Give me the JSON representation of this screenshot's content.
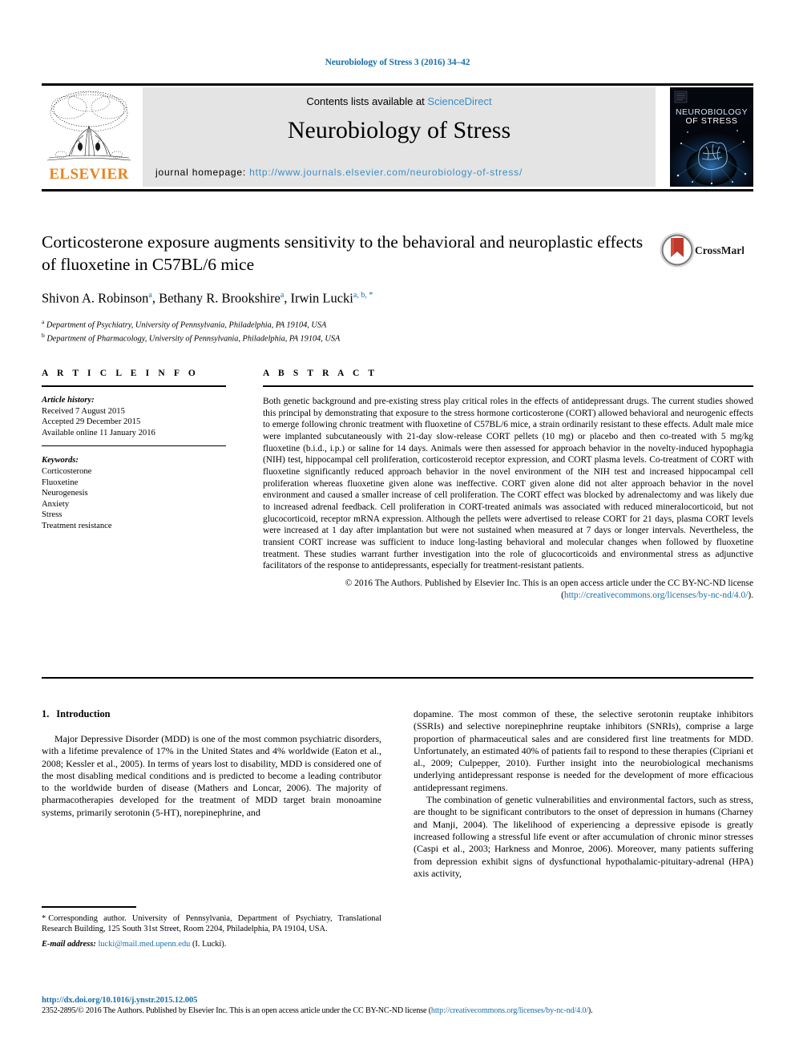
{
  "running_head": "Neurobiology of Stress 3 (2016) 34–42",
  "masthead": {
    "publisher_logo_name": "ELSEVIER",
    "contents_prefix": "Contents lists available at",
    "contents_link": "ScienceDirect",
    "journal_title": "Neurobiology of Stress",
    "homepage_label": "journal homepage:",
    "homepage_url": "http://www.journals.elsevier.com/neurobiology-of-stress/",
    "cover_line1": "NEUROBIOLOGY",
    "cover_line2": "OF STRESS"
  },
  "title_block": {
    "title": "Corticosterone exposure augments sensitivity to the behavioral and neuroplastic effects of fluoxetine in C57BL/6 mice",
    "authors": [
      {
        "name": "Shivon A. Robinson",
        "marks": "a"
      },
      {
        "name": "Bethany R. Brookshire",
        "marks": "a"
      },
      {
        "name": "Irwin Lucki",
        "marks": "a, b, *"
      }
    ],
    "affiliations": [
      {
        "mark": "a",
        "text": "Department of Psychiatry, University of Pennsylvania, Philadelphia, PA 19104, USA"
      },
      {
        "mark": "b",
        "text": "Department of Pharmacology, University of Pennsylvania, Philadelphia, PA 19104, USA"
      }
    ],
    "crossmark_label": "CrossMark"
  },
  "article_info": {
    "heading": "A R T I C L E  I N F O",
    "history_label": "Article history:",
    "history": [
      "Received 7 August 2015",
      "Accepted 29 December 2015",
      "Available online 11 January 2016"
    ],
    "keywords_label": "Keywords:",
    "keywords": [
      "Corticosterone",
      "Fluoxetine",
      "Neurogenesis",
      "Anxiety",
      "Stress",
      "Treatment resistance"
    ]
  },
  "abstract": {
    "heading": "A B S T R A C T",
    "text": "Both genetic background and pre-existing stress play critical roles in the effects of antidepressant drugs. The current studies showed this principal by demonstrating that exposure to the stress hormone corticosterone (CORT) allowed behavioral and neurogenic effects to emerge following chronic treatment with fluoxetine of C57BL/6 mice, a strain ordinarily resistant to these effects. Adult male mice were implanted subcutaneously with 21-day slow-release CORT pellets (10 mg) or placebo and then co-treated with 5 mg/kg fluoxetine (b.i.d., i.p.) or saline for 14 days. Animals were then assessed for approach behavior in the novelty-induced hypophagia (NIH) test, hippocampal cell proliferation, corticosteroid receptor expression, and CORT plasma levels. Co-treatment of CORT with fluoxetine significantly reduced approach behavior in the novel environment of the NIH test and increased hippocampal cell proliferation whereas fluoxetine given alone was ineffective. CORT given alone did not alter approach behavior in the novel environment and caused a smaller increase of cell proliferation. The CORT effect was blocked by adrenalectomy and was likely due to increased adrenal feedback. Cell proliferation in CORT-treated animals was associated with reduced mineralocorticoid, but not glucocorticoid, receptor mRNA expression. Although the pellets were advertised to release CORT for 21 days, plasma CORT levels were increased at 1 day after implantation but were not sustained when measured at 7 days or longer intervals. Nevertheless, the transient CORT increase was sufficient to induce long-lasting behavioral and molecular changes when followed by fluoxetine treatment. These studies warrant further investigation into the role of glucocorticoids and environmental stress as adjunctive facilitators of the response to antidepressants, especially for treatment-resistant patients.",
    "copyright_text": "© 2016 The Authors. Published by Elsevier Inc. This is an open access article under the CC BY-NC-ND license (",
    "copyright_link": "http://creativecommons.org/licenses/by-nc-nd/4.0/",
    "copyright_tail": ")."
  },
  "body": {
    "section_number": "1.",
    "section_title": "Introduction",
    "left_paragraphs": [
      "Major Depressive Disorder (MDD) is one of the most common psychiatric disorders, with a lifetime prevalence of 17% in the United States and 4% worldwide (Eaton et al., 2008; Kessler et al., 2005). In terms of years lost to disability, MDD is considered one of the most disabling medical conditions and is predicted to become a leading contributor to the worldwide burden of disease (Mathers and Loncar, 2006). The majority of pharmacotherapies developed for the treatment of MDD target brain monoamine systems, primarily serotonin (5-HT), norepinephrine, and"
    ],
    "right_paragraphs": [
      "dopamine. The most common of these, the selective serotonin reuptake inhibitors (SSRIs) and selective norepinephrine reuptake inhibitors (SNRIs), comprise a large proportion of pharmaceutical sales and are considered first line treatments for MDD. Unfortunately, an estimated 40% of patients fail to respond to these therapies (Cipriani et al., 2009; Culpepper, 2010). Further insight into the neurobiological mechanisms underlying antidepressant response is needed for the development of more efficacious antidepressant regimens.",
      "The combination of genetic vulnerabilities and environmental factors, such as stress, are thought to be significant contributors to the onset of depression in humans (Charney and Manji, 2004). The likelihood of experiencing a depressive episode is greatly increased following a stressful life event or after accumulation of chronic minor stresses (Caspi et al., 2003; Harkness and Monroe, 2006). Moreover, many patients suffering from depression exhibit signs of dysfunctional hypothalamic-pituitary-adrenal (HPA) axis activity,"
    ]
  },
  "footnotes": {
    "corresponding": "Corresponding author. University of Pennsylvania, Department of Psychiatry, Translational Research Building, 125 South 31st Street, Room 2204, Philadelphia, PA 19104, USA.",
    "email_label": "E-mail address:",
    "email": "lucki@mail.med.upenn.edu",
    "email_owner": "(I. Lucki)."
  },
  "footer": {
    "doi": "http://dx.doi.org/10.1016/j.ynstr.2015.12.005",
    "issn_text": "2352-2895/© 2016 The Authors. Published by Elsevier Inc. This is an open access article under the CC BY-NC-ND license (",
    "issn_link": "http://creativecommons.org/licenses/by-nc-nd/4.0/",
    "issn_tail": ")."
  },
  "colors": {
    "link_blue": "#1a6fa8",
    "sciencedirect_blue": "#3b8ec4",
    "elsevier_orange": "#E8821E"
  }
}
